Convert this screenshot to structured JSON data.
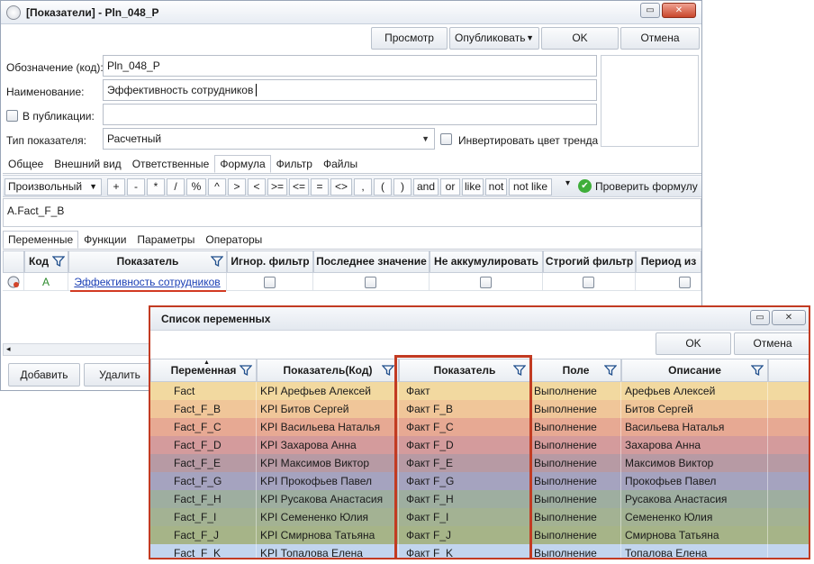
{
  "window": {
    "title": "[Показатели] - Pln_048_P",
    "btn_minimize": "▭",
    "btn_close": "✕"
  },
  "toolbar": {
    "preview": "Просмотр",
    "publish": "Опубликовать",
    "ok": "OK",
    "cancel": "Отмена"
  },
  "form": {
    "code_label": "Обозначение (код):",
    "code_value": "Pln_048_P",
    "name_label": "Наименование:",
    "name_value": "Эффективность сотрудников",
    "publication_label": "В публикации:",
    "publication_value": "",
    "type_label": "Тип показателя:",
    "type_value": "Расчетный",
    "invert_label": "Инвертировать цвет тренда"
  },
  "tabs": [
    "Общее",
    "Внешний вид",
    "Ответственные",
    "Формула",
    "Фильтр",
    "Файлы"
  ],
  "formula_bar": {
    "mode": "Произвольный",
    "operators": [
      "+",
      "-",
      "*",
      "/",
      "%",
      "^",
      ">",
      "<",
      ">=",
      "<=",
      "=",
      "<>",
      ",",
      "(",
      ")",
      "and",
      "or",
      "like",
      "not",
      "not like"
    ],
    "check_formula": "Проверить формулу"
  },
  "formula_text": "A.Fact_F_B",
  "sub_tabs": [
    "Переменные",
    "Функции",
    "Параметры",
    "Операторы"
  ],
  "variables_grid": {
    "headers": [
      "Код",
      "Показатель",
      "Игнор. фильтр",
      "Последнее значение",
      "Не аккумулировать",
      "Строгий фильтр",
      "Период из"
    ],
    "row": {
      "code": "A",
      "indicator": "Эффективность сотрудников"
    }
  },
  "bottom": {
    "add": "Добавить",
    "delete": "Удалить"
  },
  "dialog": {
    "title": "Список переменных",
    "ok": "OK",
    "cancel": "Отмена",
    "headers": [
      "Переменная",
      "Показатель(Код)",
      "Показатель",
      "Поле",
      "Описание"
    ],
    "rows": [
      {
        "var": "Fact",
        "code": "KPI Арефьев Алексей",
        "ind": "Факт",
        "field": "Выполнение",
        "desc": "Арефьев Алексей",
        "color": "#f2d9a0"
      },
      {
        "var": "Fact_F_B",
        "code": "KPI Битов Сергей",
        "ind": "Факт F_B",
        "field": "Выполнение",
        "desc": "Битов Сергей",
        "color": "#f0c699"
      },
      {
        "var": "Fact_F_C",
        "code": "KPI Васильева Наталья",
        "ind": "Факт F_C",
        "field": "Выполнение",
        "desc": "Васильева Наталья",
        "color": "#e7a993"
      },
      {
        "var": "Fact_F_D",
        "code": "KPI Захарова Анна",
        "ind": "Факт F_D",
        "field": "Выполнение",
        "desc": "Захарова Анна",
        "color": "#d49b9c"
      },
      {
        "var": "Fact_F_E",
        "code": "KPI Максимов Виктор",
        "ind": "Факт F_E",
        "field": "Выполнение",
        "desc": "Максимов Виктор",
        "color": "#b79aa4"
      },
      {
        "var": "Fact_F_G",
        "code": "KPI Прокофьев Павел",
        "ind": "Факт F_G",
        "field": "Выполнение",
        "desc": "Прокофьев Павел",
        "color": "#a5a3bf"
      },
      {
        "var": "Fact_F_H",
        "code": "KPI Русакова Анастасия",
        "ind": "Факт F_H",
        "field": "Выполнение",
        "desc": "Русакова Анастасия",
        "color": "#9eaea0"
      },
      {
        "var": "Fact_F_I",
        "code": "KPI Семененко Юлия",
        "ind": "Факт F_I",
        "field": "Выполнение",
        "desc": "Семененко Юлия",
        "color": "#a3b293"
      },
      {
        "var": "Fact_F_J",
        "code": "KPI Смирнова Татьяна",
        "ind": "Факт F_J",
        "field": "Выполнение",
        "desc": "Смирнова Татьяна",
        "color": "#a6b488"
      },
      {
        "var": "Fact_F_K",
        "code": "KPI Топалова Елена",
        "ind": "Факт F_K",
        "field": "Выполнение",
        "desc": "Топалова Елена",
        "color": "#c2d5ee"
      }
    ]
  },
  "colors": {
    "accent_red": "#c23b22",
    "link_blue": "#1a3fb5"
  }
}
